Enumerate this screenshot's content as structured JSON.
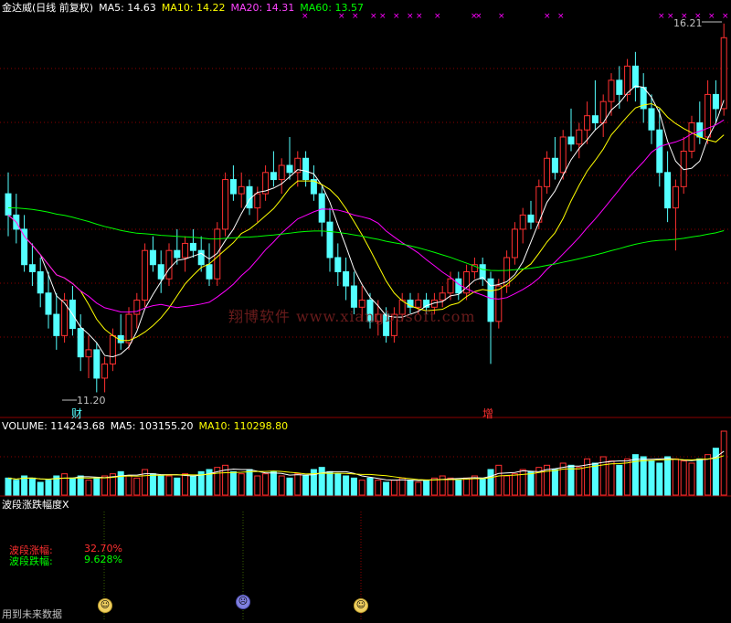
{
  "header": {
    "title": "金达威(日线 前复权)",
    "ma5_label": "MA5: 14.63",
    "ma10_label": "MA10: 14.22",
    "ma20_label": "MA20: 14.31",
    "ma60_label": "MA60: 13.57"
  },
  "price_labels": {
    "high": "16.21",
    "low": "11.20",
    "marker_cai": "财",
    "marker_zeng": "增"
  },
  "volume_header": {
    "title": "VOLUME: 114243.68",
    "ma5_label": "MA5: 103155.20",
    "ma10_label": "MA10: 110298.80"
  },
  "indicator": {
    "title": "波段涨跌幅度X",
    "rise_label": "波段涨幅:",
    "rise_value": "32.70%",
    "fall_label": "波段跌幅:",
    "fall_value": "9.628%",
    "footer_note": "用到未来数据"
  },
  "watermark": "翔博软件 www.xiangbosoft.com",
  "colors": {
    "up": "#ff3030",
    "down": "#54ffff",
    "ma5": "#ffffff",
    "ma10": "#ffff00",
    "ma20": "#ff00ff",
    "ma60": "#00ff00",
    "grid": "#8b0000",
    "rise": "#ff3030",
    "fall": "#00ff00"
  },
  "icons": [
    "happy-face-icon",
    "sad-face-icon",
    "happy-face-icon",
    "cross-signal-icon"
  ],
  "chart_data": {
    "type": "candlestick",
    "title": "金达威(日线 前复权)",
    "visible_high": 16.21,
    "visible_low": 11.2,
    "ma_latest": {
      "MA5": 14.63,
      "MA10": 14.22,
      "MA20": 14.31,
      "MA60": 13.57
    },
    "volume_latest": {
      "VOLUME": 114243.68,
      "MA5": 103155.2,
      "MA10": 110298.8
    },
    "ohlc": [
      [
        14.0,
        14.3,
        13.4,
        13.7
      ],
      [
        13.7,
        14.0,
        13.3,
        13.5
      ],
      [
        13.5,
        13.7,
        12.9,
        13.0
      ],
      [
        13.0,
        13.3,
        12.7,
        12.9
      ],
      [
        12.9,
        13.1,
        12.4,
        12.6
      ],
      [
        12.6,
        12.9,
        12.1,
        12.3
      ],
      [
        12.3,
        12.6,
        11.8,
        12.0
      ],
      [
        12.0,
        12.6,
        11.9,
        12.5
      ],
      [
        12.5,
        12.7,
        12.0,
        12.1
      ],
      [
        12.1,
        12.3,
        11.5,
        11.7
      ],
      [
        11.7,
        12.0,
        11.4,
        11.8
      ],
      [
        11.8,
        11.9,
        11.2,
        11.4
      ],
      [
        11.4,
        11.7,
        11.2,
        11.6
      ],
      [
        11.6,
        12.1,
        11.5,
        12.0
      ],
      [
        12.0,
        12.3,
        11.8,
        11.9
      ],
      [
        11.9,
        12.4,
        11.8,
        12.3
      ],
      [
        12.3,
        12.6,
        12.1,
        12.5
      ],
      [
        12.5,
        13.3,
        12.4,
        13.2
      ],
      [
        13.2,
        13.4,
        12.9,
        13.0
      ],
      [
        13.0,
        13.2,
        12.6,
        12.8
      ],
      [
        12.8,
        13.3,
        12.7,
        13.2
      ],
      [
        13.2,
        13.5,
        13.0,
        13.1
      ],
      [
        13.1,
        13.4,
        12.9,
        13.3
      ],
      [
        13.3,
        13.5,
        13.1,
        13.2
      ],
      [
        13.2,
        13.4,
        12.9,
        13.0
      ],
      [
        13.0,
        13.3,
        12.7,
        12.8
      ],
      [
        12.8,
        13.6,
        12.7,
        13.5
      ],
      [
        13.5,
        14.3,
        13.4,
        14.2
      ],
      [
        14.2,
        14.4,
        13.9,
        14.0
      ],
      [
        14.0,
        14.3,
        13.8,
        14.1
      ],
      [
        14.1,
        14.2,
        13.7,
        13.8
      ],
      [
        13.8,
        14.1,
        13.6,
        14.0
      ],
      [
        14.0,
        14.4,
        13.9,
        14.3
      ],
      [
        14.3,
        14.6,
        14.1,
        14.2
      ],
      [
        14.2,
        14.5,
        14.0,
        14.4
      ],
      [
        14.4,
        14.8,
        14.2,
        14.3
      ],
      [
        14.3,
        14.6,
        14.1,
        14.5
      ],
      [
        14.5,
        14.6,
        14.1,
        14.2
      ],
      [
        14.2,
        14.4,
        13.9,
        14.0
      ],
      [
        14.0,
        14.1,
        13.4,
        13.6
      ],
      [
        13.6,
        13.8,
        12.9,
        13.1
      ],
      [
        13.1,
        13.3,
        12.7,
        12.9
      ],
      [
        12.9,
        13.1,
        12.5,
        12.7
      ],
      [
        12.7,
        12.9,
        12.3,
        12.4
      ],
      [
        12.4,
        12.7,
        12.2,
        12.5
      ],
      [
        12.5,
        12.6,
        12.1,
        12.2
      ],
      [
        12.2,
        12.5,
        12.0,
        12.3
      ],
      [
        12.3,
        12.4,
        11.9,
        12.0
      ],
      [
        12.0,
        12.4,
        11.9,
        12.3
      ],
      [
        12.3,
        12.6,
        12.2,
        12.5
      ],
      [
        12.5,
        12.6,
        12.3,
        12.4
      ],
      [
        12.4,
        12.6,
        12.3,
        12.5
      ],
      [
        12.5,
        12.6,
        12.3,
        12.4
      ],
      [
        12.4,
        12.6,
        12.3,
        12.5
      ],
      [
        12.5,
        12.7,
        12.4,
        12.6
      ],
      [
        12.6,
        12.9,
        12.5,
        12.8
      ],
      [
        12.8,
        12.9,
        12.5,
        12.6
      ],
      [
        12.6,
        13.0,
        12.5,
        12.9
      ],
      [
        12.9,
        13.1,
        12.8,
        13.0
      ],
      [
        13.0,
        13.1,
        12.7,
        12.8
      ],
      [
        12.8,
        12.9,
        11.6,
        12.2
      ],
      [
        12.2,
        12.8,
        12.1,
        12.7
      ],
      [
        12.7,
        13.2,
        12.6,
        13.1
      ],
      [
        13.1,
        13.6,
        13.0,
        13.5
      ],
      [
        13.5,
        13.8,
        13.3,
        13.7
      ],
      [
        13.7,
        13.9,
        13.5,
        13.6
      ],
      [
        13.6,
        14.2,
        13.5,
        14.1
      ],
      [
        14.1,
        14.6,
        14.0,
        14.5
      ],
      [
        14.5,
        14.8,
        14.2,
        14.3
      ],
      [
        14.3,
        14.9,
        14.2,
        14.8
      ],
      [
        14.8,
        15.2,
        14.6,
        14.7
      ],
      [
        14.7,
        15.0,
        14.5,
        14.9
      ],
      [
        14.9,
        15.3,
        14.7,
        15.1
      ],
      [
        15.1,
        15.6,
        14.9,
        15.0
      ],
      [
        15.0,
        15.4,
        14.8,
        15.3
      ],
      [
        15.3,
        15.7,
        15.1,
        15.6
      ],
      [
        15.6,
        15.8,
        15.2,
        15.4
      ],
      [
        15.4,
        15.9,
        15.3,
        15.8
      ],
      [
        15.8,
        16.0,
        15.3,
        15.5
      ],
      [
        15.5,
        15.7,
        15.0,
        15.2
      ],
      [
        15.2,
        15.4,
        14.7,
        14.9
      ],
      [
        14.9,
        15.2,
        14.1,
        14.3
      ],
      [
        14.3,
        14.6,
        13.6,
        13.8
      ],
      [
        13.8,
        14.2,
        13.2,
        14.1
      ],
      [
        14.1,
        14.8,
        14.0,
        14.6
      ],
      [
        14.6,
        15.1,
        14.5,
        15.0
      ],
      [
        15.0,
        15.3,
        14.7,
        14.8
      ],
      [
        14.8,
        15.6,
        14.7,
        15.4
      ],
      [
        15.4,
        15.6,
        15.0,
        15.2
      ],
      [
        15.2,
        16.4,
        15.1,
        16.2
      ]
    ],
    "volume_scale": [
      8,
      7,
      9,
      8,
      6,
      7,
      9,
      10,
      8,
      9,
      7,
      8,
      9,
      10,
      11,
      9,
      8,
      12,
      10,
      9,
      9,
      8,
      10,
      9,
      11,
      12,
      13,
      14,
      11,
      10,
      12,
      9,
      10,
      11,
      9,
      8,
      10,
      9,
      12,
      13,
      11,
      10,
      9,
      8,
      7,
      8,
      7,
      6,
      7,
      8,
      7,
      6,
      7,
      8,
      9,
      8,
      7,
      8,
      9,
      8,
      12,
      14,
      9,
      10,
      12,
      11,
      13,
      14,
      12,
      15,
      14,
      13,
      17,
      15,
      18,
      16,
      14,
      17,
      19,
      18,
      16,
      15,
      18,
      17,
      16,
      15,
      17,
      19,
      22,
      30
    ]
  }
}
